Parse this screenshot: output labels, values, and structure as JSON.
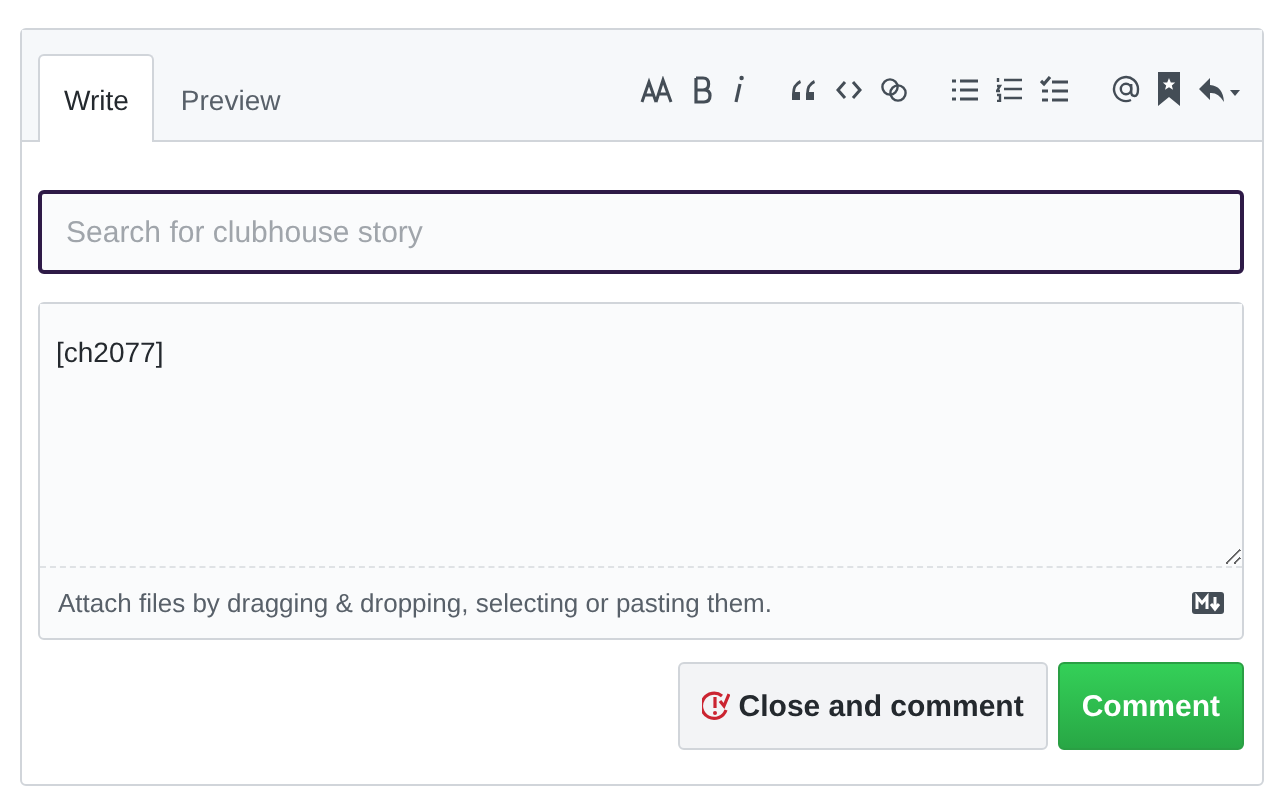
{
  "tabs": [
    {
      "label": "Write",
      "selected": true
    },
    {
      "label": "Preview",
      "selected": false
    }
  ],
  "search": {
    "placeholder": "Search for clubhouse story"
  },
  "comment": {
    "value": "[ch2077]"
  },
  "attach_hint": "Attach files by dragging & dropping, selecting or pasting them.",
  "buttons": [
    {
      "label": "Close and comment",
      "kind": "close"
    },
    {
      "label": "Comment",
      "kind": "primary"
    }
  ]
}
